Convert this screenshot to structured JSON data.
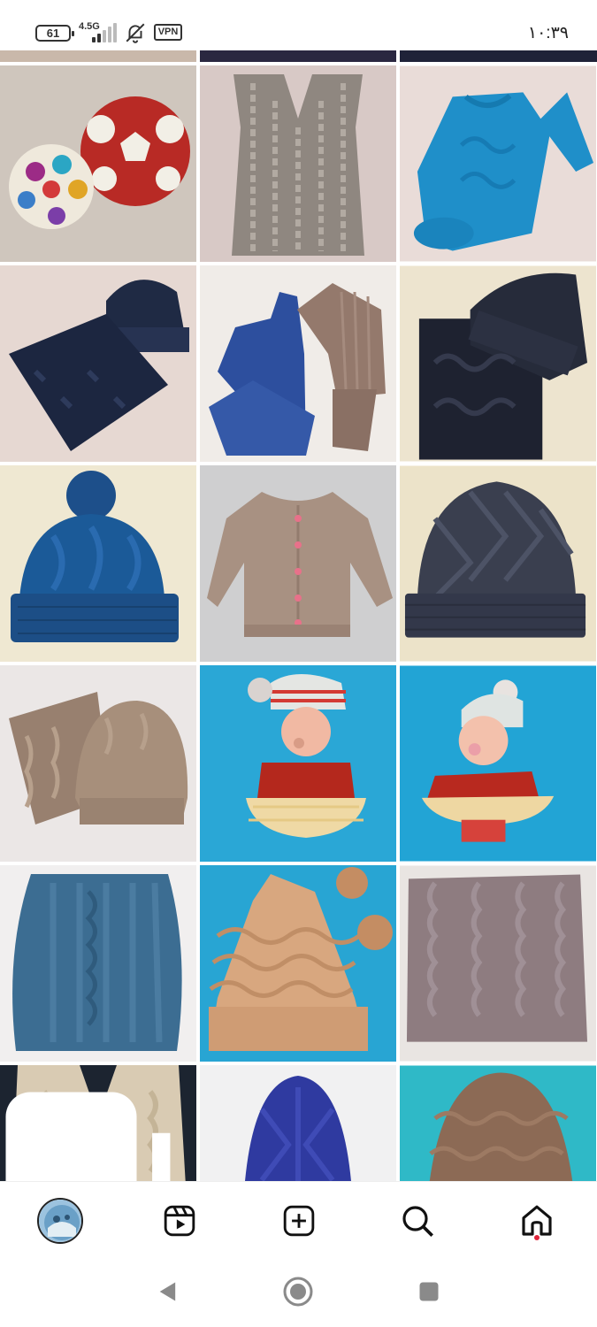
{
  "status_bar": {
    "battery": "61",
    "network": "4.5G",
    "vpn": "VPN",
    "time": "۱۰:۳۹",
    "icons": [
      "battery-icon",
      "signal-icon",
      "mute-icon",
      "vpn-icon"
    ]
  },
  "grid": {
    "items": [
      {
        "name": "crochet-balls-post",
        "description_icon": "image"
      },
      {
        "name": "cable-vest-post",
        "description_icon": "image"
      },
      {
        "name": "blue-sweater-post",
        "description_icon": "image"
      },
      {
        "name": "navy-hat-cowl-post",
        "description_icon": "image"
      },
      {
        "name": "fingerless-gloves-post",
        "description_icon": "image"
      },
      {
        "name": "dark-hat-cowl-post",
        "description_icon": "image"
      },
      {
        "name": "blue-pompom-hat-post",
        "description_icon": "image"
      },
      {
        "name": "beige-cardigan-post",
        "description_icon": "image"
      },
      {
        "name": "grey-beanie-post",
        "description_icon": "image"
      },
      {
        "name": "tan-hat-cowl-post",
        "description_icon": "image"
      },
      {
        "name": "doll-dress-post",
        "description_icon": "image"
      },
      {
        "name": "doll-dress-2-post",
        "description_icon": "image"
      },
      {
        "name": "blue-cowl-post",
        "description_icon": "image"
      },
      {
        "name": "wave-hat-post",
        "description_icon": "image"
      },
      {
        "name": "mauve-cowl-post",
        "description_icon": "image"
      },
      {
        "name": "cream-vest-post",
        "description_icon": "carousel"
      },
      {
        "name": "navy-beanie-post",
        "description_icon": "image"
      },
      {
        "name": "brown-beanie-post",
        "description_icon": "image"
      }
    ]
  },
  "bottom_nav": {
    "items": [
      "profile-avatar",
      "reels-icon",
      "create-post-icon",
      "search-icon",
      "home-icon"
    ],
    "accent_color": "#e0243b"
  },
  "system_nav": {
    "items": [
      "back-icon",
      "home-button-icon",
      "recents-icon"
    ]
  }
}
